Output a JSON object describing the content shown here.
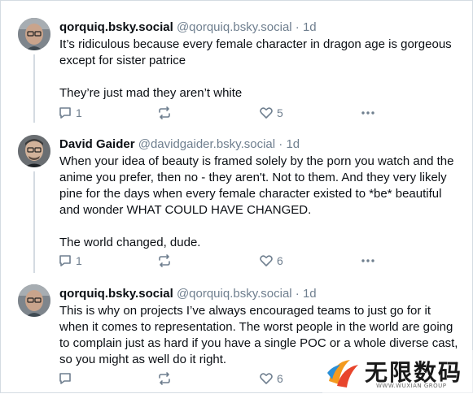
{
  "posts": [
    {
      "name": "qorquiq.bsky.social",
      "handle": "@qorquiq.bsky.social",
      "dot": "·",
      "time": "1d",
      "paragraphs": [
        "It’s ridiculous because every female character in dragon age is gorgeous except for sister patrice",
        "They’re just mad they aren’t white"
      ],
      "replies": "1",
      "reposts": "",
      "likes": "5"
    },
    {
      "name": "David Gaider",
      "handle": "@davidgaider.bsky.social",
      "dot": "·",
      "time": "1d",
      "paragraphs": [
        "When your idea of beauty is framed solely by the porn you watch and the anime you prefer, then no - they aren't. Not to them. And they very likely pine for the days when every female character existed to *be* beautiful and wonder WHAT COULD HAVE CHANGED.",
        "The world changed, dude."
      ],
      "replies": "1",
      "reposts": "",
      "likes": "6"
    },
    {
      "name": "qorquiq.bsky.social",
      "handle": "@qorquiq.bsky.social",
      "dot": "·",
      "time": "1d",
      "paragraphs": [
        "This is why on projects I’ve always encouraged teams to just go for it when it comes to representation. The worst people in the world are going to complain just as hard if you have a single POC or a whole diverse cast, so you might as well do it right."
      ],
      "replies": "",
      "reposts": "",
      "likes": "6"
    }
  ],
  "watermark": {
    "text": "无限数码",
    "sub": "WWW.WUXIAN GROUP"
  },
  "colors": {
    "text": "#0b0f14",
    "muted": "#6f7f8f",
    "border": "#d4dbe2"
  }
}
